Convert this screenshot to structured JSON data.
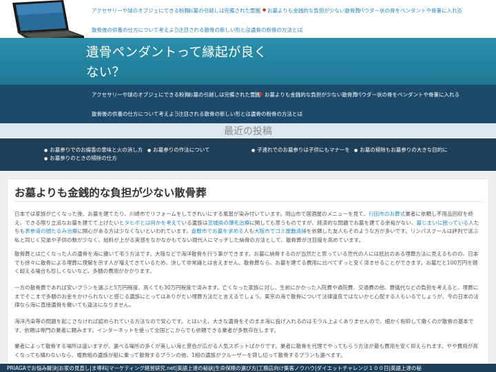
{
  "header": {
    "site_title": "遺骨ペンダントって縁起が良くない？",
    "nav_top": [
      "アクセサリーや球のオブジェにできる粉骨",
      "お墓の引越しは完備された霊園",
      "お墓よりも金銭的な負担が少ない散骨葬",
      "パウダー状の骨をペンダントや骨董に入れる",
      "散骨後の供養の仕方について考えよう",
      "注目される散骨の新しい形とは",
      "遺骨の粉骨の方法とは"
    ],
    "nav_main": [
      "アクセサリーや球のオブジェにできる粉骨",
      "お墓の引越しは完備された霊園",
      "お墓よりも金銭的な負担が少ない散骨葬",
      "パウダー状の骨をペンダントや骨董に入れる",
      "散骨後の供養の仕方について考えよう",
      "注目される散骨の新しい形とは",
      "遺骨の粉骨の方法とは"
    ]
  },
  "recent": {
    "heading": "最近の投稿",
    "items": [
      "お墓参りでのお線香の意味と火の消し方",
      "お墓参りの作法について",
      "子連れでのお墓参りは子供にもマナーを",
      "お墓の掃除もお墓参りの大きな目的に",
      "お墓参りのときの掃除の仕方"
    ]
  },
  "article": {
    "title": "お墓よりも金銭的な負担が少ない散骨葬",
    "p1": {
      "a": "日本では家族が亡くなった後、お墓を建てたり、川崎市でリフォームをしてきれいにする風習が染み付いています。岡山市で居酒屋のメニューを見て、",
      "link1": "行田市のお葬式",
      "b": "業者に依頼し不用品回収を終え、できる限り立派なお墓を建てて上げたいと",
      "link2": "タヒボとは何かを考えて",
      "c": "いる遺族は",
      "link3": "茨城県の薄毛治療",
      "d": "に関しても思うものですが、経済的な問題でお墓を建てる余裕がない、",
      "link4": "墓じまいに困っている",
      "e": "人たちも",
      "link5": "表参道の顔たるみ治療",
      "f": "に関心がある方は少なくないといわれています。",
      "link6": "倉敷市でお墓を求める",
      "g": "人も",
      "link7": "大阪市でゴミ屋敷清掃",
      "h": "を依頼した友人もそのような方が多いです。リンパスクールは評判で派ぶ私と同じく兄弟や子供の数が少なく、給料が上がる実感をなかなかもてない現代人にマッチした納骨の方法として、散骨葬が注目度を高めています。"
    },
    "p2": "散骨葬とは亡くなった人の遺骨を海に撒いて弔う方法です。大阪などで海洋散骨を行う事ができます。お墓に納骨するのが当然だと思っている世代の人には抵抗のある埋葬方法に見えるものの、日本でも徐々に散骨による埋葬に理解を示す人が増えてきているため、決して非常識とは言えません。散骨葬なら、お墓を建てる費用に比べてずっと安く済ませることができます。お墓だと100万円を軽く超える場合も珍しくないなど、多額の費用がかかります。",
    "p3": "一方の散骨葬であれば安いプランを選ぶと5万円程度、高くても30万円程度で済みます。亡くなった家族に対し、生前にかかった入院費や通院費、交通費の他、葬儀代などの負担を考えると、埋葬にまでそこまで多額のお金をかけられないと感じる遺族にとってはありがたい埋葬方法だと言えるでしょう。東京の海で散骨について法律違反ではないかと心配する人もいるでしょうが、今の日本の法律なら海に直接遺骨を撒いても違法になりません。",
    "p4": "海洋汚染等の問題を起こさなければ認められている方法なので安心です。とはいえ、大きな遺骨をそのまま海に投げ入れるのはモラル上よくありませんので、細かく粉砕して撒くのが散骨の基本です。依頼は専門の業者に頼みます。インターネットを使って全国どこからでも依頼できる業者が多数存在します。",
    "p5": "業者によって散骨する場所は違いますが、選べる場所の多くが美しい海と景色が広がる人気スポットばかりです。業者に散骨を代理でやってもらう方法が最も費用を安く抑えられます。やや費用が高くなっても構わないなら、複数組の遺族が船に乗って散骨するプランの他、1組の遺族がクルーザーを貸し切って散骨するプランも選べます。"
  },
  "footer": {
    "links": "PRIAGAでお悩み解決|お家の見直し|ま専科|マーケティング経営研究.net|英語上達の秘訣|生命保険の選び方|工務店向け集客ノウハウ|ダイエットチャレンジ１００日|英語上達の秘"
  },
  "colors": {
    "teal": "#1f7896",
    "navy": "#1d4a6b",
    "dark_navy": "#1f3f59",
    "link": "#2b87c1"
  }
}
